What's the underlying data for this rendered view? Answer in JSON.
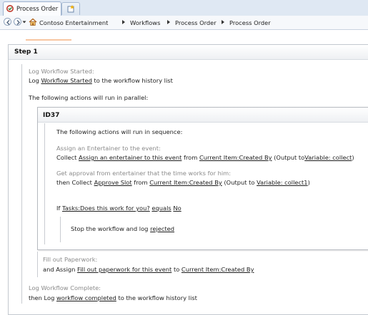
{
  "tab": {
    "title": "Process Order"
  },
  "breadcrumb": [
    "Contoso Entertainment",
    "Workflows",
    "Process Order",
    "Process Order"
  ],
  "step": {
    "title": "Step 1",
    "log_started": {
      "comment": "Log Workflow Started:",
      "pre": "Log",
      "link": "Workflow Started",
      "post": "to the workflow history list"
    },
    "parallel_text": "The following actions will run in parallel:",
    "parallel_block": {
      "title": "ID37",
      "sequence_text": "The following actions will run in sequence:",
      "assign": {
        "comment": "Assign an Entertainer to the event:",
        "pre": "Collect",
        "link1": "Assign an entertainer to this event",
        "mid1": "from",
        "link2": "Current Item:Created By",
        "mid2": "(Output to",
        "link3": "Variable: collect",
        "post": ")"
      },
      "approval": {
        "comment": "Get approval from entertainer that the time works for him:",
        "pre": "then Collect",
        "link1": "Approve Slot",
        "mid1": "from",
        "link2": "Current Item:Created By",
        "mid2": "(Output to",
        "link3": "Variable: collect1",
        "post": ")"
      },
      "condition": {
        "pre": "If",
        "link1": "Tasks:Does this work for you?",
        "link2": "equals",
        "link3": "No"
      },
      "stop": {
        "pre": "Stop the workflow and log",
        "link": "rejected"
      }
    },
    "paperwork": {
      "comment": "Fill out Paperwork:",
      "pre": "and Assign",
      "link1": "Fill out paperwork for this event",
      "mid": "to",
      "link2": "Current Item:Created By"
    },
    "log_complete": {
      "comment": "Log Workflow Complete:",
      "pre": "then Log",
      "link": "workflow completed",
      "post": "to the workflow history list"
    }
  }
}
